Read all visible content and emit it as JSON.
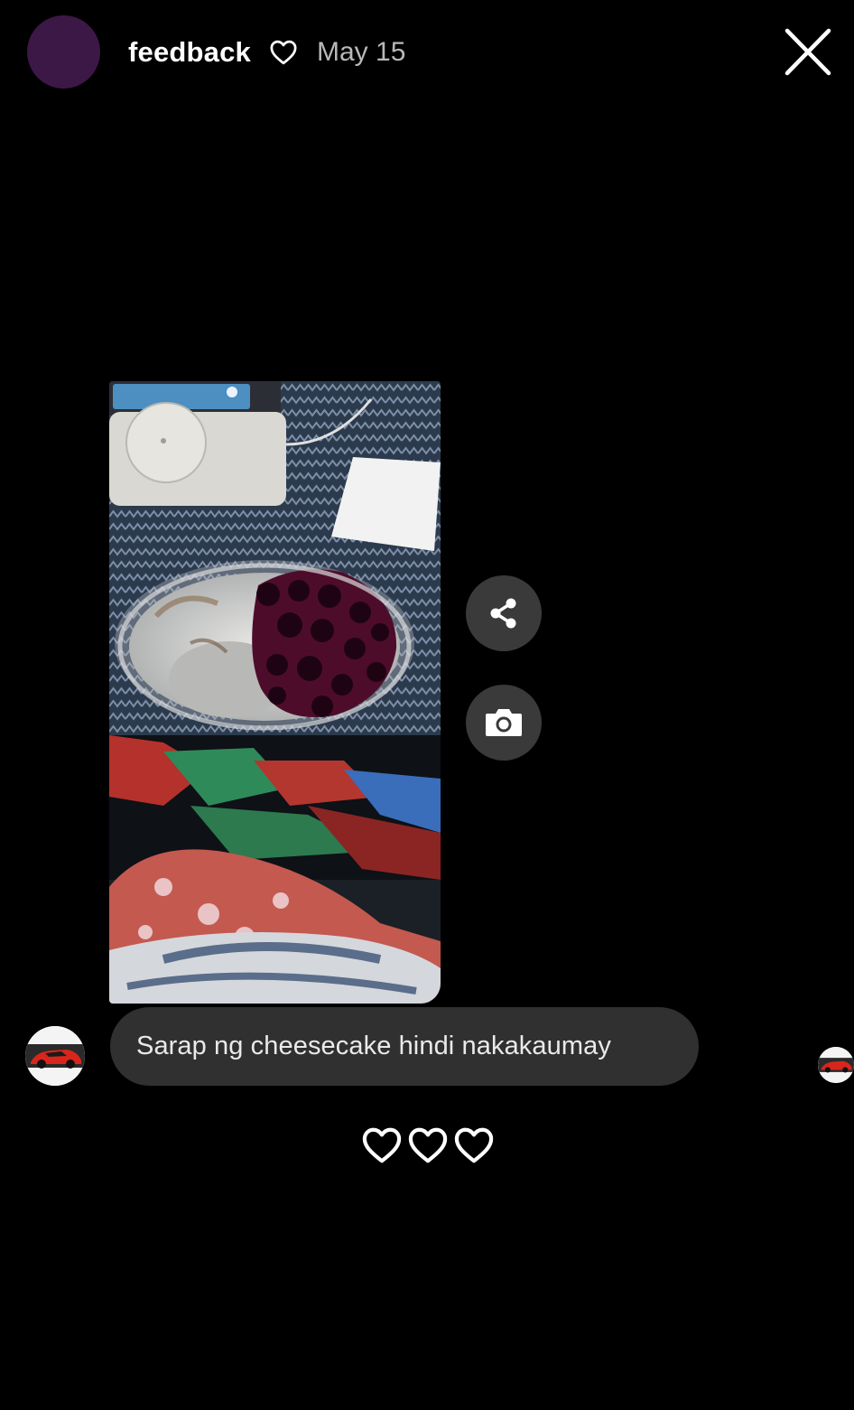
{
  "header": {
    "username": "feedback",
    "date": "May 15",
    "avatar_color": "#3c1846"
  },
  "icons": {
    "header_heart": "heart-outline-icon",
    "close": "close-icon",
    "share": "share-icon",
    "camera": "camera-icon",
    "reaction": "heart-outline-icon"
  },
  "message": {
    "text": "Sarap ng cheesecake hindi nakakaumay",
    "bubble_color": "#303030"
  },
  "reactions": {
    "count": 3
  }
}
